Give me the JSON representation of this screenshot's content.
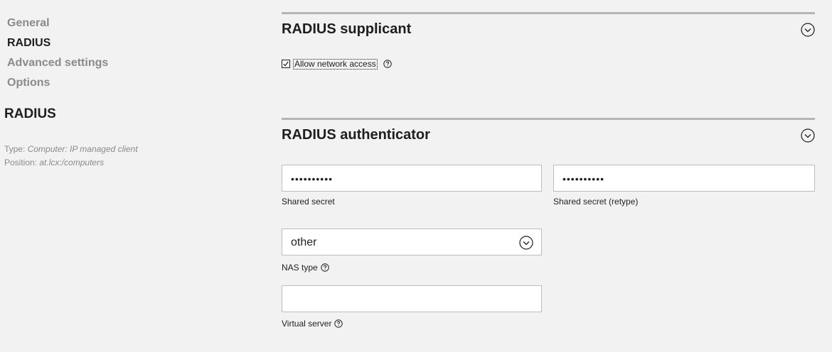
{
  "nav": {
    "items": [
      {
        "label": "General",
        "active": false
      },
      {
        "label": "RADIUS",
        "active": true
      },
      {
        "label": "Advanced settings",
        "active": false
      },
      {
        "label": "Options",
        "active": false
      }
    ]
  },
  "object": {
    "title": "RADIUS",
    "type_label": "Type:",
    "type_value": "Computer: IP managed client",
    "position_label": "Position:",
    "position_value": "at.lcx:/computers"
  },
  "supplicant": {
    "title": "RADIUS supplicant",
    "allow_network_access": {
      "label": "Allow network access",
      "checked": true
    }
  },
  "authenticator": {
    "title": "RADIUS authenticator",
    "shared_secret": {
      "value": "••••••••••",
      "label": "Shared secret"
    },
    "shared_secret_retype": {
      "value": "••••••••••",
      "label": "Shared secret (retype)"
    },
    "nas_type": {
      "value": "other",
      "label": "NAS type"
    },
    "virtual_server": {
      "value": "",
      "label": "Virtual server"
    }
  },
  "icons": {
    "section_toggle": "chevron-down-circle-icon",
    "help": "help-circle-icon",
    "checkbox": "checkmark-icon"
  }
}
